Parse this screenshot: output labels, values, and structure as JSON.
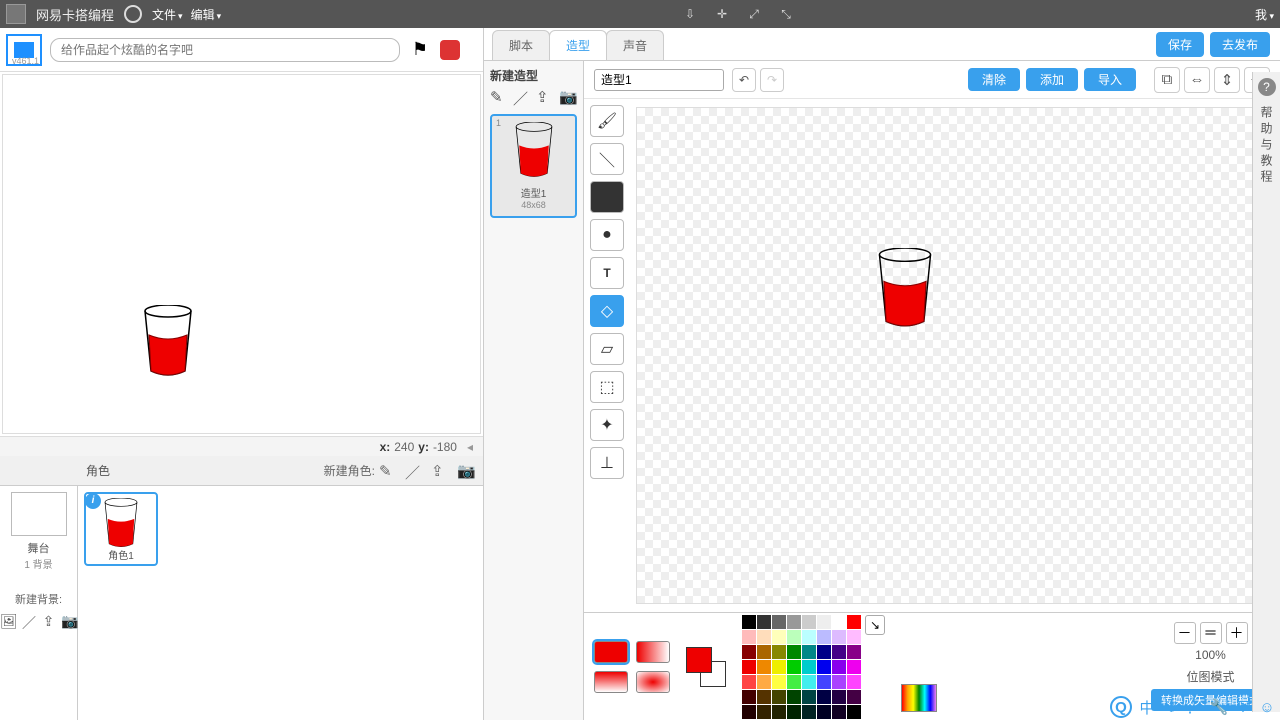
{
  "topbar": {
    "brand": "网易卡搭编程",
    "menu_file": "文件",
    "menu_edit": "编辑",
    "me": "我"
  },
  "header": {
    "title_placeholder": "给作品起个炫酷的名字吧",
    "version": "v461.1"
  },
  "stage": {
    "x_label": "x:",
    "x_value": "240",
    "y_label": "y:",
    "y_value": "-180"
  },
  "sprites": {
    "label": "角色",
    "new_label": "新建角色:",
    "stage_label": "舞台",
    "stage_sub": "1 背景",
    "new_bg": "新建背景:",
    "items": [
      {
        "name": "角色1"
      }
    ]
  },
  "tabs": {
    "scripts": "脚本",
    "costumes": "造型",
    "sounds": "声音"
  },
  "buttons": {
    "save": "保存",
    "publish": "去发布",
    "clear": "清除",
    "add": "添加",
    "import": "导入"
  },
  "costume": {
    "panel_title": "新建造型",
    "current_name": "造型1",
    "thumb": {
      "num": "1",
      "name": "造型1",
      "size": "48x68"
    }
  },
  "zoom": {
    "value": "100%"
  },
  "mode": {
    "label": "位图模式",
    "switch": "转换成矢量编辑模式"
  },
  "help": {
    "text": "帮助与教程"
  },
  "palette": [
    "#000",
    "#333",
    "#666",
    "#999",
    "#ccc",
    "#eee",
    "#fff",
    "#f00",
    "#fbb",
    "#fdb",
    "#ffb",
    "#bfb",
    "#bff",
    "#bbf",
    "#dbf",
    "#fbf",
    "#800",
    "#a60",
    "#880",
    "#080",
    "#088",
    "#008",
    "#408",
    "#808",
    "#e00",
    "#e80",
    "#ee0",
    "#0c0",
    "#0cc",
    "#00e",
    "#80e",
    "#e0e",
    "#f44",
    "#fa4",
    "#ff4",
    "#4e4",
    "#4ee",
    "#44f",
    "#a4f",
    "#f4f",
    "#400",
    "#530",
    "#440",
    "#040",
    "#044",
    "#004",
    "#204",
    "#404",
    "#200",
    "#320",
    "#220",
    "#020",
    "#022",
    "#002",
    "#102",
    "#000"
  ],
  "chart_data": null
}
